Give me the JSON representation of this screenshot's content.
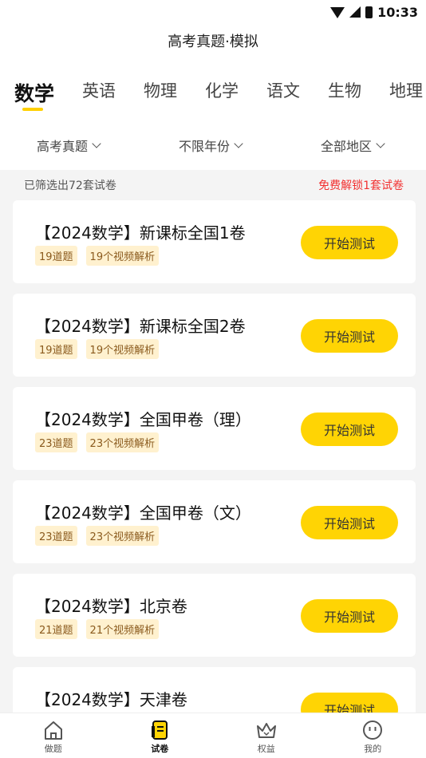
{
  "status_bar": {
    "time": "10:33"
  },
  "app_title": "高考真题·模拟",
  "subject_tabs": [
    {
      "label": "数学",
      "active": true
    },
    {
      "label": "英语",
      "active": false
    },
    {
      "label": "物理",
      "active": false
    },
    {
      "label": "化学",
      "active": false
    },
    {
      "label": "语文",
      "active": false
    },
    {
      "label": "生物",
      "active": false
    },
    {
      "label": "地理",
      "active": false
    }
  ],
  "filters": [
    {
      "label": "高考真题"
    },
    {
      "label": "不限年份"
    },
    {
      "label": "全部地区"
    }
  ],
  "info": {
    "count_text": "已筛选出72套试卷",
    "unlock_text": "免费解锁1套试卷"
  },
  "papers": [
    {
      "title": "【2024数学】新课标全国1卷",
      "questions": "19道题",
      "videos": "19个视频解析",
      "button": "开始测试"
    },
    {
      "title": "【2024数学】新课标全国2卷",
      "questions": "19道题",
      "videos": "19个视频解析",
      "button": "开始测试"
    },
    {
      "title": "【2024数学】全国甲卷（理）",
      "questions": "23道题",
      "videos": "23个视频解析",
      "button": "开始测试"
    },
    {
      "title": "【2024数学】全国甲卷（文）",
      "questions": "23道题",
      "videos": "23个视频解析",
      "button": "开始测试"
    },
    {
      "title": "【2024数学】北京卷",
      "questions": "21道题",
      "videos": "21个视频解析",
      "button": "开始测试"
    },
    {
      "title": "【2024数学】天津卷",
      "questions": "",
      "videos": "",
      "button": "开始测试"
    }
  ],
  "bottom_nav": [
    {
      "label": "做题",
      "icon": "home-icon",
      "active": false
    },
    {
      "label": "试卷",
      "icon": "paper-icon",
      "active": true
    },
    {
      "label": "权益",
      "icon": "crown-icon",
      "active": false
    },
    {
      "label": "我的",
      "icon": "profile-icon",
      "active": false
    }
  ],
  "colors": {
    "accent": "#ffd404",
    "unlock_red": "#f23030",
    "tag_bg": "#fff1cf"
  }
}
